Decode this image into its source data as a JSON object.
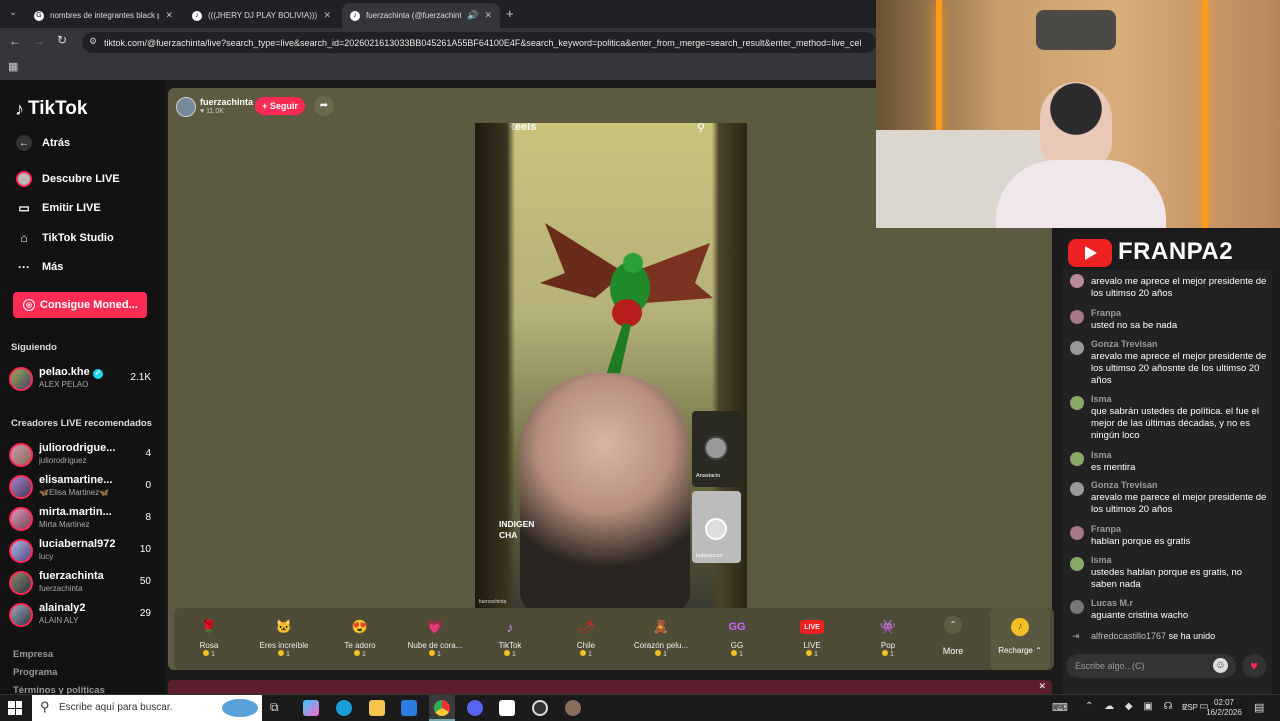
{
  "browser": {
    "tabs": [
      {
        "title": "nombres de integrantes black p",
        "favicon": "G"
      },
      {
        "title": "(((JHERY DJ PLAY BOLIVIA))) (@",
        "favicon": "♪"
      },
      {
        "title": "fuerzachinta (@fuerzachinta",
        "favicon": "♪"
      }
    ],
    "new_tab": "+",
    "url": "tiktok.com/@fuerzachinta/live?search_type=live&search_id=2026021613033BB045261A55BF64100E4F&search_keyword=politica&enter_from_merge=search_result&enter_method=live_cel"
  },
  "sidebar": {
    "logo": "TikTok",
    "back_label": "Atrás",
    "nav": [
      {
        "label": "Descubre LIVE",
        "icon": "live-avatar-icon"
      },
      {
        "label": "Emitir LIVE",
        "icon": "camera-icon"
      },
      {
        "label": "TikTok Studio",
        "icon": "studio-icon"
      },
      {
        "label": "Más",
        "icon": "more-icon"
      }
    ],
    "coins_button": "Consigue Moned...",
    "following_title": "Siguiendo",
    "following": [
      {
        "name": "pelao.khe",
        "sub": "ALEX PELAO",
        "count": "2.1K",
        "verified": true
      }
    ],
    "recommended_title": "Creadores LIVE recomendados",
    "recommended": [
      {
        "name": "juliorodrigue...",
        "sub": "juliorodriguez",
        "count": "4"
      },
      {
        "name": "elisamartine...",
        "sub": "🦋Elisa Martinez🦋",
        "count": "0"
      },
      {
        "name": "mirta.martin...",
        "sub": "Mirta Martinez",
        "count": "8"
      },
      {
        "name": "luciabernal972",
        "sub": "lucy",
        "count": "10"
      },
      {
        "name": "fuerzachinta",
        "sub": "fuerzachinta",
        "count": "50"
      },
      {
        "name": "alainaly2",
        "sub": "ALAIN ALY",
        "count": "29"
      }
    ],
    "footer": [
      "Empresa",
      "Programa",
      "Términos y políticas"
    ]
  },
  "live": {
    "host_name": "fuerzachinta",
    "host_likes": "11.0K",
    "follow_label": "+ Seguir",
    "stream_top_text": "Reels",
    "stream_caption": "INDIGEN\nCHA",
    "guest1_name": "Anastacio",
    "guest2_name": "babyoocco",
    "watermark": "fuerzachinta",
    "gifts": [
      {
        "name": "Rosa",
        "price": "1",
        "icon": "rose-icon",
        "glyph": "🌹"
      },
      {
        "name": "Eres increíble",
        "price": "1",
        "icon": "cat-icon",
        "glyph": "🐱"
      },
      {
        "name": "Te adoro",
        "price": "1",
        "icon": "heart-face-icon",
        "glyph": "😍"
      },
      {
        "name": "Nube de cora...",
        "price": "1",
        "icon": "heart-cloud-icon",
        "glyph": "💗"
      },
      {
        "name": "TikTok",
        "price": "1",
        "icon": "tiktok-icon",
        "glyph": "♪"
      },
      {
        "name": "Chile",
        "price": "1",
        "icon": "chili-icon",
        "glyph": "🌶"
      },
      {
        "name": "Corazón pelu...",
        "price": "1",
        "icon": "fluffy-heart-icon",
        "glyph": "🧸"
      },
      {
        "name": "GG",
        "price": "1",
        "icon": "gg-icon",
        "glyph": "GG"
      },
      {
        "name": "LIVE",
        "price": "1",
        "icon": "live-icon",
        "glyph": "LIVE"
      },
      {
        "name": "Pop",
        "price": "1",
        "icon": "pop-icon",
        "glyph": "👾"
      }
    ],
    "more_label": "More",
    "recharge_label": "Recharge"
  },
  "overlay": {
    "brand": "FRANPA2"
  },
  "chat": {
    "messages": [
      {
        "name": "",
        "text": "arevalo me aprece el mejor presidente de los ultimso 20 años"
      },
      {
        "name": "Franpa",
        "text": "usted no sa be nada"
      },
      {
        "name": "Gonza Trevisan",
        "text": "arevalo me aprece el mejor presidente de los ultimso 20 añosnte de los ultimso 20 años"
      },
      {
        "name": "Isma",
        "text": "que sabrán ustedes de política. el fue el mejor de las últimas décadas, y no es ningún loco"
      },
      {
        "name": "Isma",
        "text": "es mentira"
      },
      {
        "name": "Gonza Trevisan",
        "text": "arevalo me parece el mejor presidente de los ultimos 20 años"
      },
      {
        "name": "Franpa",
        "text": "hablan porque es gratis"
      },
      {
        "name": "Isma",
        "text": "ustedes hablan porque es gratis, no saben nada"
      },
      {
        "name": "Lucas M.r",
        "text": "aguante cristina wacho"
      }
    ],
    "join_user": "alfredocastillo1767",
    "join_text": "se ha unido",
    "input_placeholder": "Escribe algo...(C)"
  },
  "taskbar": {
    "search_placeholder": "Escribe aquí para buscar.",
    "lang": "ESP",
    "time": "02:07",
    "date": "16/2/2026"
  }
}
